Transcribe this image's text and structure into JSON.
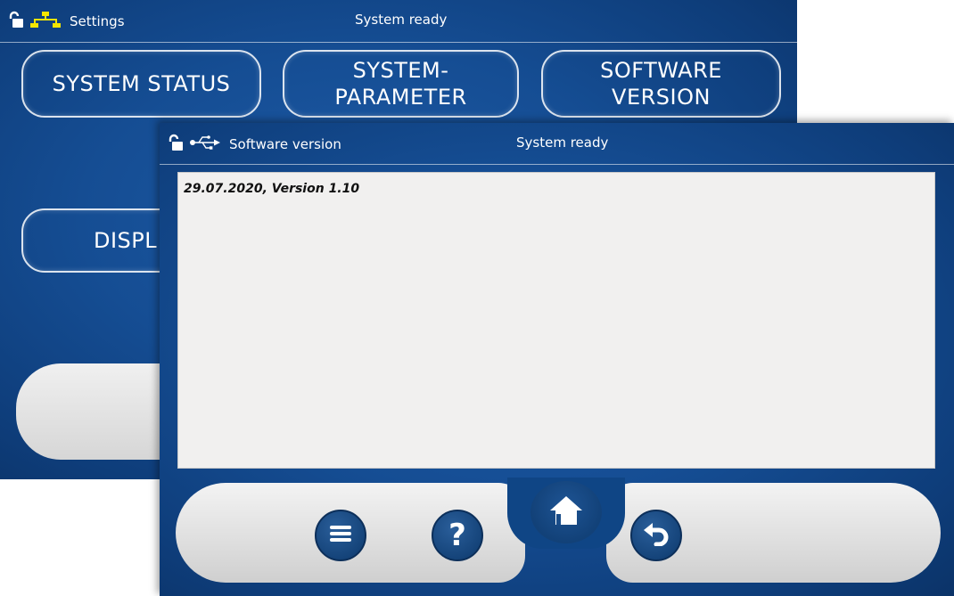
{
  "back_screen": {
    "status_title": "Settings",
    "status_center": "System ready",
    "buttons": {
      "system_status": "SYSTEM STATUS",
      "system_parameter_line1": "SYSTEM-",
      "system_parameter_line2": "PARAMETER",
      "software_version_line1": "SOFTWARE",
      "software_version_line2": "VERSION",
      "display_partial": "DISPL"
    },
    "icons": [
      "unlock-icon",
      "network-icon"
    ]
  },
  "front_screen": {
    "status_title": "Software version",
    "status_center": "System ready",
    "content": {
      "version_line": "29.07.2020, Version 1.10"
    },
    "icons": [
      "unlock-icon",
      "usb-icon"
    ],
    "bottom_bar": [
      "menu-icon",
      "help-icon",
      "home-icon",
      "undo-icon"
    ],
    "help_glyph": "?"
  },
  "colors": {
    "panel_blue": "#154d93",
    "accent_yellow": "#f5e600",
    "content_bg": "#f1f0ef"
  }
}
